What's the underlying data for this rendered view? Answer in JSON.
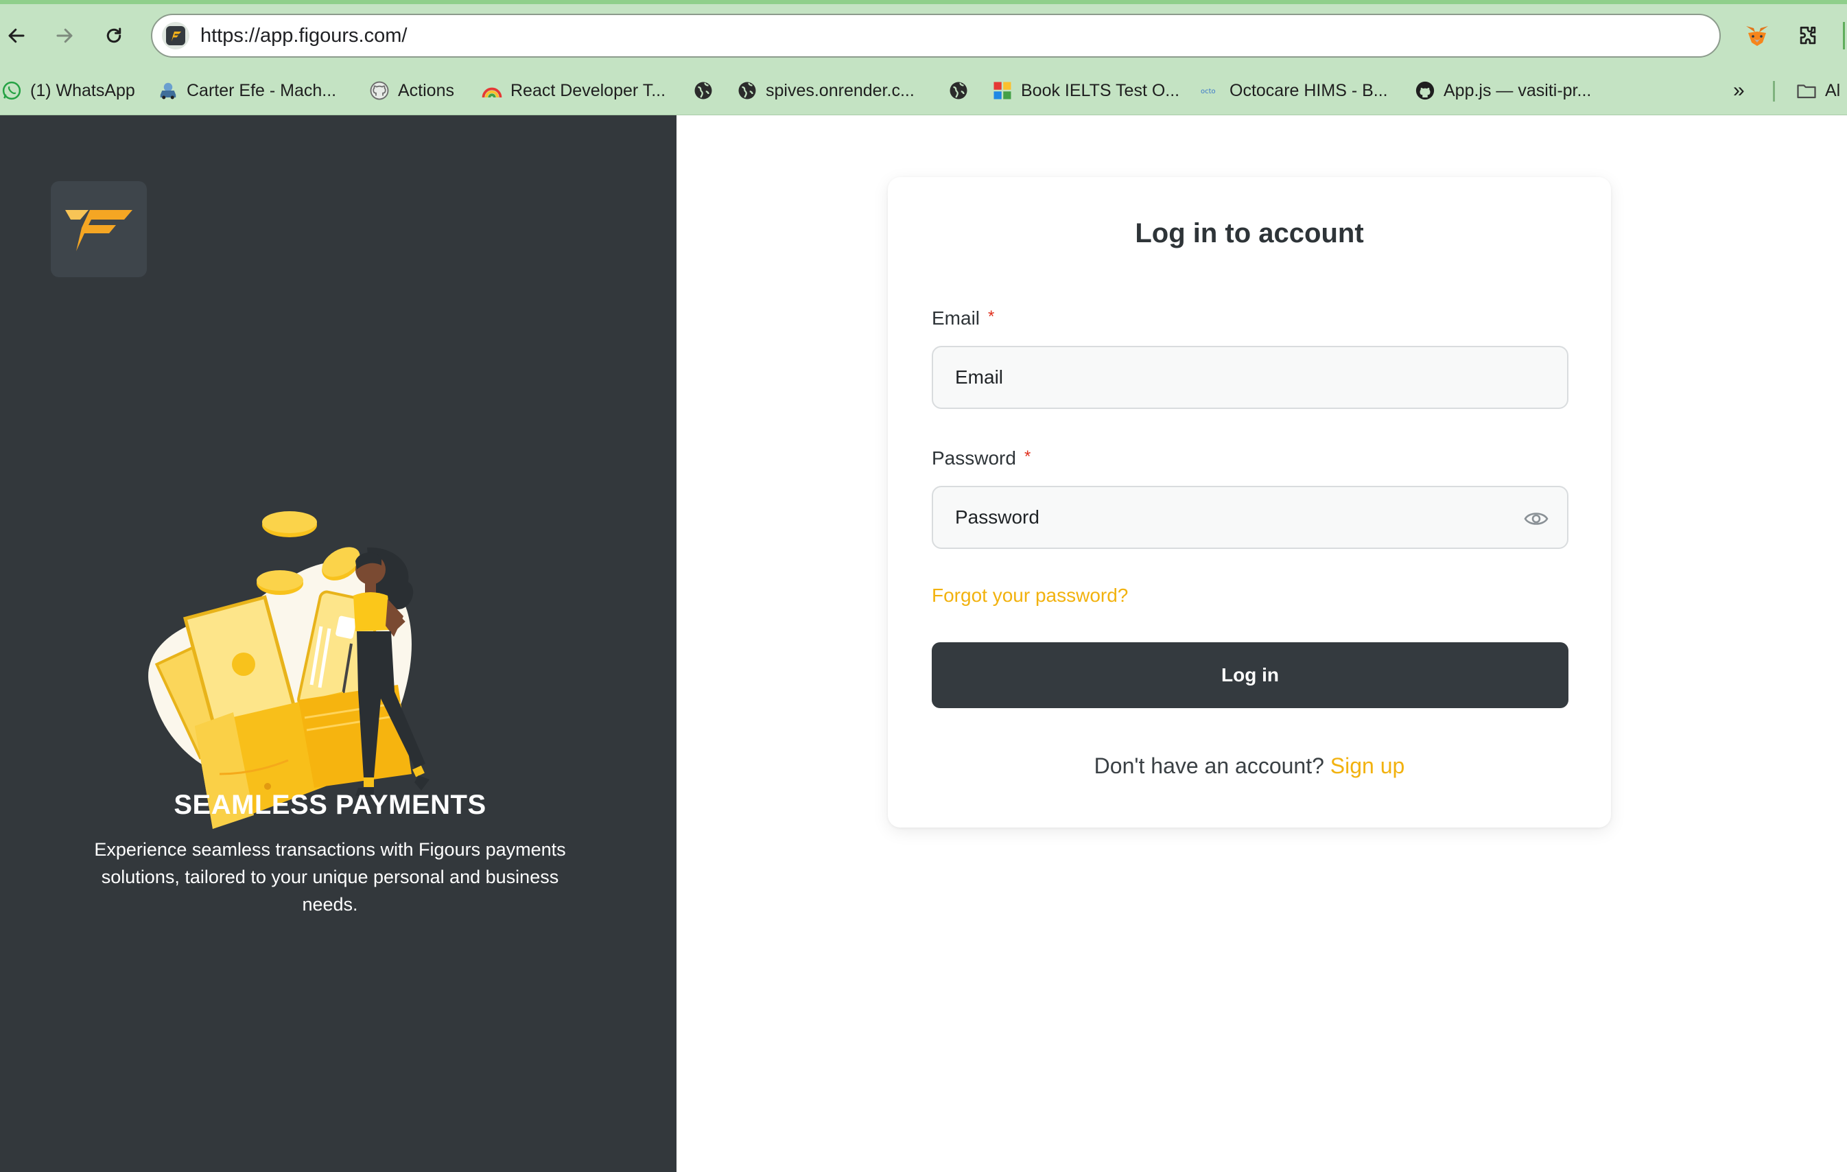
{
  "browser": {
    "url": "https://app.figours.com/",
    "bookmarks": [
      {
        "label": "(1) WhatsApp",
        "icon": "whatsapp-icon"
      },
      {
        "label": "Carter Efe - Mach...",
        "icon": "car-icon"
      },
      {
        "label": "Actions",
        "icon": "github-icon"
      },
      {
        "label": "React Developer T...",
        "icon": "rainbow-icon"
      },
      {
        "label": "",
        "icon": "globe-icon"
      },
      {
        "label": "spives.onrender.c...",
        "icon": "globe-icon"
      },
      {
        "label": "",
        "icon": "globe-icon"
      },
      {
        "label": "Book IELTS Test O...",
        "icon": "ielts-icon"
      },
      {
        "label": "Octocare HIMS - B...",
        "icon": "octocare-icon"
      },
      {
        "label": "App.js — vasiti-pr...",
        "icon": "github-icon"
      }
    ],
    "overflow_label": "»",
    "folder_label": "Al"
  },
  "hero": {
    "title": "SEAMLESS PAYMENTS",
    "description": "Experience seamless transactions with Figours payments solutions, tailored to your unique personal and business needs."
  },
  "login": {
    "title": "Log in to account",
    "email_label": "Email",
    "email_placeholder": "Email",
    "password_label": "Password",
    "password_placeholder": "Password",
    "required_mark": "*",
    "forgot_link": "Forgot your password?",
    "submit_label": "Log in",
    "signup_prompt": "Don't have an account?",
    "signup_link": "Sign up"
  },
  "colors": {
    "brand_dark": "#343a3f",
    "accent_yellow": "#f2b20f",
    "browser_chrome": "#c4e3c3"
  }
}
